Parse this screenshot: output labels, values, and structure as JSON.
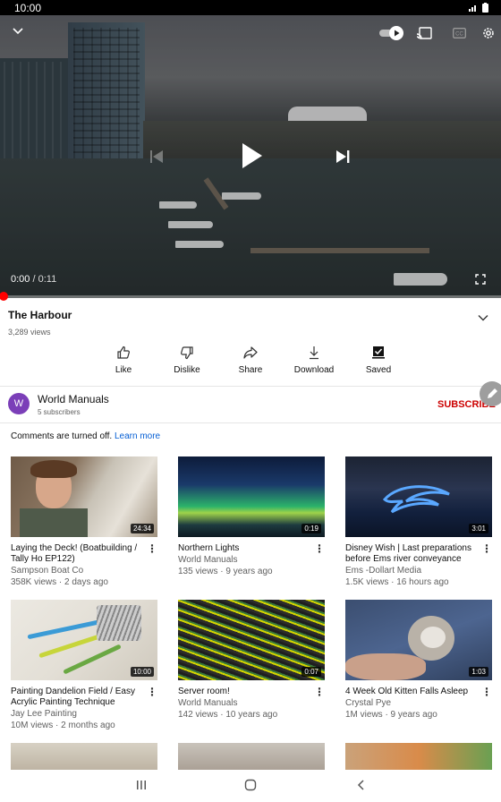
{
  "status_bar": {
    "time": "10:00"
  },
  "player": {
    "current_time": "0:00",
    "separator": "/",
    "duration": "0:11",
    "progress": 0
  },
  "video": {
    "title": "The Harbour",
    "views": "3,289 views"
  },
  "actions": [
    {
      "label": "Like",
      "icon": "thumb-up-icon"
    },
    {
      "label": "Dislike",
      "icon": "thumb-down-icon"
    },
    {
      "label": "Share",
      "icon": "share-icon"
    },
    {
      "label": "Download",
      "icon": "download-icon"
    },
    {
      "label": "Saved",
      "icon": "saved-icon"
    }
  ],
  "channel": {
    "avatar_letter": "W",
    "name": "World Manuals",
    "subscribers": "5 subscribers",
    "subscribe_label": "SUBSCRIBE"
  },
  "comments": {
    "text": "Comments are turned off.",
    "link": "Learn more"
  },
  "recommendations": [
    {
      "title": "Laying the Deck! (Boatbuilding / Tally Ho EP122)",
      "channel": "Sampson Boat Co",
      "meta": "358K views · 2 days ago",
      "duration": "24:34"
    },
    {
      "title": "Northern Lights",
      "channel": "World Manuals",
      "meta": "135 views · 9 years ago",
      "duration": "0:19"
    },
    {
      "title": "Disney Wish | Last preparations before  Ems river conveyance",
      "channel": "Ems -Dollart Media",
      "meta": "1.5K views · 16 hours ago",
      "duration": "3:01"
    },
    {
      "title": "Painting Dandelion Field / Easy Acrylic Painting Technique",
      "channel": "Jay Lee Painting",
      "meta": "10M views · 2 months ago",
      "duration": "10:00"
    },
    {
      "title": "Server room!",
      "channel": "World Manuals",
      "meta": "142 views · 10 years ago",
      "duration": "0:07"
    },
    {
      "title": "4 Week Old Kitten Falls Asleep",
      "channel": "Crystal Pye",
      "meta": "1M views · 9 years ago",
      "duration": "1:03"
    }
  ],
  "colors": {
    "accent_red": "#ff0000",
    "subscribe": "#cc0000",
    "link": "#065fd4",
    "avatar": "#7b3fb8"
  }
}
